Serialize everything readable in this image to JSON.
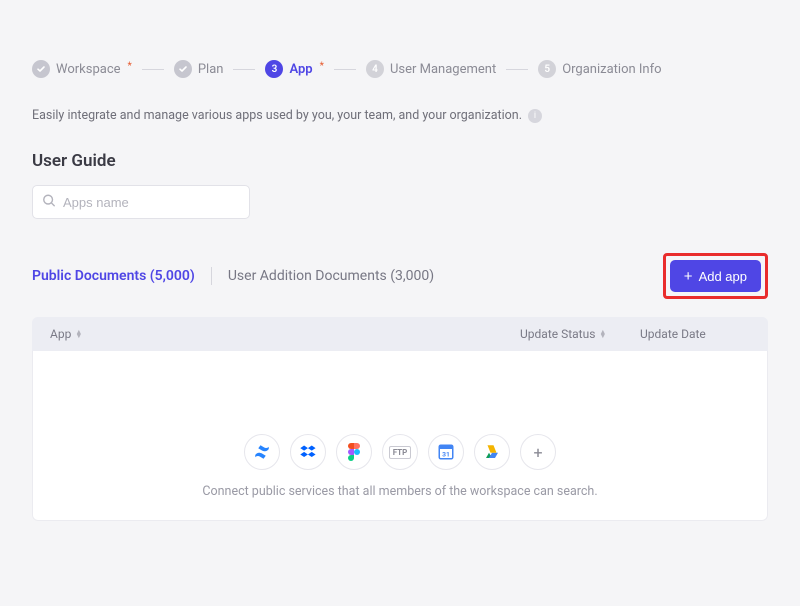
{
  "stepper": {
    "workspace": "Workspace",
    "plan": "Plan",
    "app_num": "3",
    "app": "App",
    "um_num": "4",
    "user_management": "User Management",
    "oi_num": "5",
    "organization_info": "Organization Info"
  },
  "intro": "Easily integrate and manage various apps used by you, your team, and your organization.",
  "section_title": "User Guide",
  "search": {
    "placeholder": "Apps name"
  },
  "tabs": {
    "public": "Public Documents (5,000)",
    "user_addition": "User Addition Documents (3,000)"
  },
  "add_button": "Add app",
  "table": {
    "col_app": "App",
    "col_update_status": "Update Status",
    "col_update_date": "Update Date"
  },
  "empty_text": "Connect public services that all members of the workspace can search.",
  "services": {
    "confluence": "confluence",
    "dropbox": "dropbox",
    "figma": "figma",
    "ftp": "ftp",
    "google_calendar": "google-calendar",
    "google_drive": "google-drive",
    "more": "more"
  }
}
